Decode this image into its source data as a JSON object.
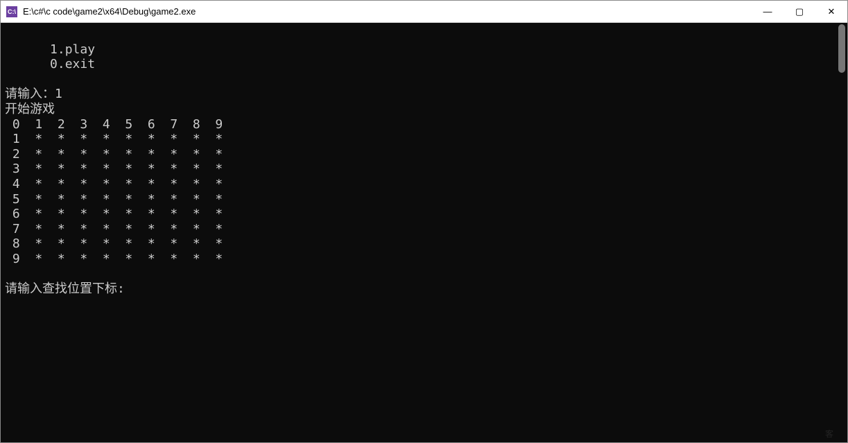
{
  "window": {
    "title": "E:\\c#\\c code\\game2\\x64\\Debug\\game2.exe",
    "icon_label": "C:\\"
  },
  "controls": {
    "minimize": "—",
    "maximize": "▢",
    "close": "✕"
  },
  "console": {
    "menu_line1": "      1.play",
    "menu_line2": "      0.exit",
    "blank": "",
    "input_prompt": "请输入：1",
    "start_msg": "开始游戏",
    "grid_header": " 0  1  2  3  4  5  6  7  8  9",
    "grid_rows": [
      " 1  *  *  *  *  *  *  *  *  *",
      " 2  *  *  *  *  *  *  *  *  *",
      " 3  *  *  *  *  *  *  *  *  *",
      " 4  *  *  *  *  *  *  *  *  *",
      " 5  *  *  *  *  *  *  *  *  *",
      " 6  *  *  *  *  *  *  *  *  *",
      " 7  *  *  *  *  *  *  *  *  *",
      " 8  *  *  *  *  *  *  *  *  *",
      " 9  *  *  *  *  *  *  *  *  *"
    ],
    "lookup_prompt": "请输入查找位置下标:"
  },
  "watermark": "客"
}
